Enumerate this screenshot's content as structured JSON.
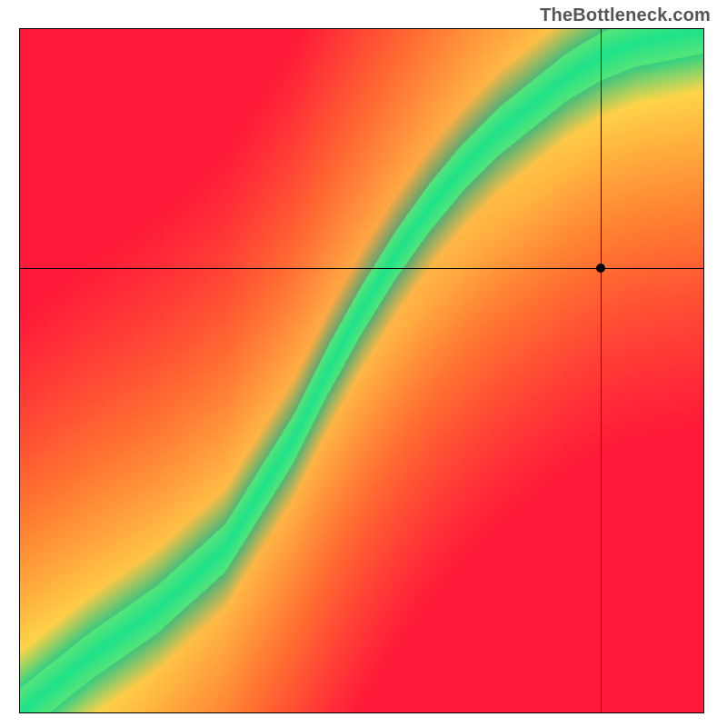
{
  "watermark": "TheBottleneck.com",
  "chart_data": {
    "type": "heatmap",
    "title": "",
    "xlabel": "",
    "ylabel": "",
    "xlim": [
      0,
      100
    ],
    "ylim": [
      0,
      100
    ],
    "colorscale_note": "red = bottleneck, green = balanced; diagonal optimal band curving from lower-left to upper-right",
    "optimal_band": {
      "description": "Green band of balanced CPU/GPU pairing",
      "points_xy": [
        [
          0,
          0
        ],
        [
          10,
          8
        ],
        [
          20,
          15
        ],
        [
          30,
          24
        ],
        [
          35,
          32
        ],
        [
          40,
          40
        ],
        [
          45,
          50
        ],
        [
          50,
          59
        ],
        [
          55,
          67
        ],
        [
          60,
          74
        ],
        [
          65,
          80
        ],
        [
          70,
          85
        ],
        [
          75,
          89
        ],
        [
          80,
          93
        ],
        [
          85,
          96
        ],
        [
          90,
          98
        ],
        [
          100,
          100
        ]
      ],
      "band_halfwidth_pct": 3.5
    },
    "selected_point": {
      "x": 85,
      "y": 65
    },
    "crosshair": {
      "x": 85,
      "y": 65
    },
    "colors": {
      "bottleneck": "#ff1a3a",
      "warn": "#ffed4a",
      "balanced": "#1fe28a",
      "mid": "#ff9a2e"
    }
  }
}
